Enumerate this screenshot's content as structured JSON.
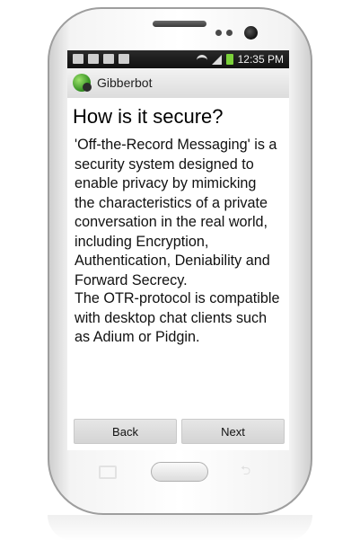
{
  "status_bar": {
    "time": "12:35 PM"
  },
  "app": {
    "title": "Gibberbot"
  },
  "content": {
    "heading": "How is it secure?",
    "paragraph_1": "'Off-the-Record Messaging' is a\nsecurity system designed to\nenable privacy by mimicking\nthe characteristics of a private\nconversation in the real world,\nincluding Encryption,\nAuthentication, Deniability and\nForward Secrecy.",
    "paragraph_2": "The OTR-protocol is compatible\nwith desktop chat clients such\nas Adium or Pidgin."
  },
  "buttons": {
    "back": "Back",
    "next": "Next"
  },
  "icons": {
    "status_left": [
      "image-icon",
      "voicemail-icon",
      "lock-icon",
      "play-store-icon"
    ],
    "status_right": [
      "wifi-icon",
      "signal-icon",
      "battery-icon"
    ],
    "app": "gibberbot-logo-icon"
  }
}
